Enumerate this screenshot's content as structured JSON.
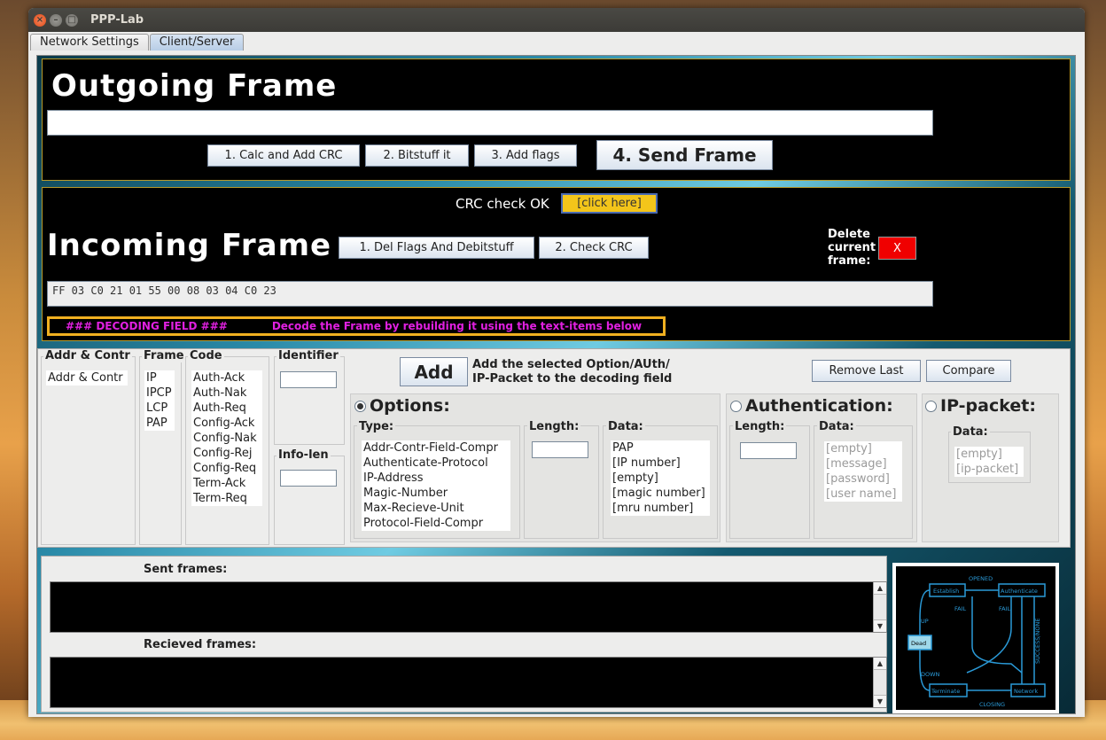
{
  "window": {
    "title": "PPP-Lab"
  },
  "tabs": [
    {
      "label": "Network Settings",
      "active": false
    },
    {
      "label": "Client/Server",
      "active": true
    }
  ],
  "outgoing": {
    "title": "Outgoing Frame",
    "frame_value": "",
    "buttons": {
      "calc_crc": "1. Calc and Add CRC",
      "bitstuff": "2. Bitstuff it",
      "add_flags": "3. Add flags",
      "send": "4. Send Frame"
    }
  },
  "incoming": {
    "crc_status": "CRC check OK",
    "click_here": "[click here]",
    "title": "Incoming Frame",
    "buttons": {
      "del_flags": "1. Del Flags And Debitstuff",
      "check_crc": "2. Check CRC"
    },
    "delete_label_1": "Delete",
    "delete_label_2": "current",
    "delete_label_3": "frame:",
    "delete_button": "X",
    "frame_value": "FF 03 C0 21 01 55 00 08 03 04 C0 23",
    "decoding_label": "###  DECODING FIELD ###",
    "decoding_hint": "Decode the Frame by rebuilding it using the text-items below"
  },
  "decoder": {
    "addr_contr": {
      "label": "Addr & Contr",
      "items": [
        "Addr & Contr"
      ]
    },
    "frame": {
      "label": "Frame",
      "items": [
        "IP",
        "IPCP",
        "LCP",
        "PAP"
      ]
    },
    "code": {
      "label": "Code",
      "items": [
        "Auth-Ack",
        "Auth-Nak",
        "Auth-Req",
        "Config-Ack",
        "Config-Nak",
        "Config-Rej",
        "Config-Req",
        "Term-Ack",
        "Term-Req"
      ]
    },
    "identifier": {
      "label": "Identifier",
      "value": ""
    },
    "info_len": {
      "label": "Info-len",
      "value": ""
    },
    "add_button": "Add",
    "add_hint_1": "Add the selected Option/AUth/",
    "add_hint_2": "IP-Packet to the decoding field",
    "remove_last": "Remove Last",
    "compare": "Compare",
    "options": {
      "title": "Options:",
      "selected": true,
      "type_label": "Type:",
      "types": [
        "Addr-Contr-Field-Compr",
        "Authenticate-Protocol",
        "IP-Address",
        "Magic-Number",
        "Max-Recieve-Unit",
        "Protocol-Field-Compr"
      ],
      "length_label": "Length:",
      "length_value": "",
      "data_label": "Data:",
      "data": [
        "PAP",
        "[IP number]",
        "[empty]",
        "[magic number]",
        "[mru number]"
      ]
    },
    "authentication": {
      "title": "Authentication:",
      "selected": false,
      "length_label": "Length:",
      "length_value": "",
      "data_label": "Data:",
      "data": [
        "[empty]",
        "[message]",
        "[password]",
        "[user name]"
      ]
    },
    "ip_packet": {
      "title": "IP-packet:",
      "selected": false,
      "data_label": "Data:",
      "data": [
        "[empty]",
        "[ip-packet]"
      ]
    }
  },
  "frames": {
    "sent_label": "Sent frames:",
    "received_label": "Recieved frames:"
  },
  "diagram": {
    "states": [
      "Establish",
      "Authenticate",
      "Dead",
      "Terminate",
      "Network"
    ],
    "labels": [
      "OPENED",
      "FAIL",
      "FAIL",
      "UP",
      "DOWN",
      "CLOSING",
      "SUCCESS/NONE"
    ]
  },
  "colors": {
    "click_here_bg": "#f3c51a",
    "delete_bg": "#f00000",
    "decoding_text": "#e020e0",
    "diagram_line": "#2a9ad8"
  }
}
